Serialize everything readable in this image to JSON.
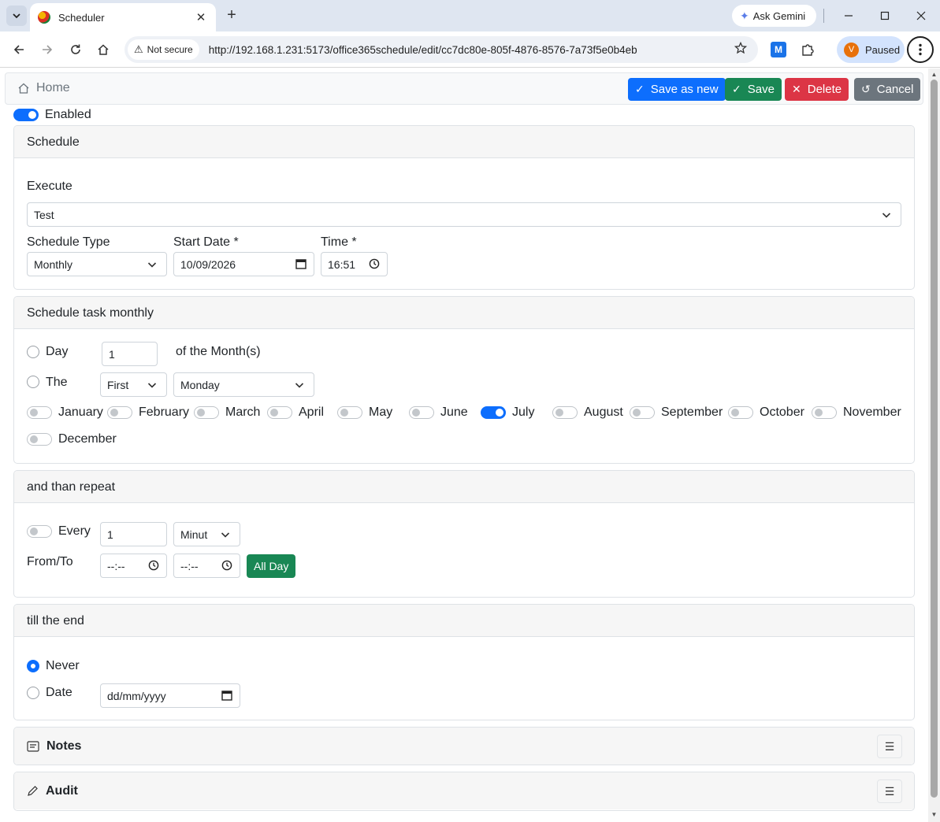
{
  "browser": {
    "tab_title": "Scheduler",
    "tab_close": "✕",
    "new_tab": "+",
    "gemini_label": "Ask Gemini",
    "security_label": "Not secure",
    "url": "http://192.168.1.231:5173/office365schedule/edit/cc7dc80e-805f-4876-8576-7a73f5e0b4eb",
    "profile_initial": "V",
    "profile_status": "Paused",
    "extension_label": "M"
  },
  "toolbar": {
    "home_label": "Home",
    "save_as_new_label": "Save as new",
    "save_label": "Save",
    "delete_label": "Delete",
    "cancel_label": "Cancel"
  },
  "enabled_label": "Enabled",
  "schedule": {
    "header": "Schedule",
    "execute_label": "Execute",
    "execute_value": "Test",
    "type_label": "Schedule Type",
    "type_value": "Monthly",
    "start_date_label": "Start Date *",
    "start_date_value": "10/09/2026",
    "time_label": "Time *",
    "time_value": "16:51"
  },
  "monthly": {
    "header": "Schedule task monthly",
    "day_label": "Day",
    "day_value": "1",
    "of_month_label": "of the Month(s)",
    "the_label": "The",
    "ordinal_value": "First",
    "weekday_value": "Monday",
    "months": [
      {
        "label": "January",
        "on": false
      },
      {
        "label": "February",
        "on": false
      },
      {
        "label": "March",
        "on": false
      },
      {
        "label": "April",
        "on": false
      },
      {
        "label": "May",
        "on": false
      },
      {
        "label": "June",
        "on": false
      },
      {
        "label": "July",
        "on": true
      },
      {
        "label": "August",
        "on": false
      },
      {
        "label": "September",
        "on": false
      },
      {
        "label": "October",
        "on": false
      },
      {
        "label": "November",
        "on": false
      },
      {
        "label": "December",
        "on": false
      }
    ]
  },
  "repeat": {
    "header": "and than repeat",
    "every_label": "Every",
    "every_value": "1",
    "unit_value": "Minut",
    "fromto_label": "From/To",
    "from_value": "--:--",
    "to_value": "--:--",
    "allday_label": "All Day"
  },
  "end": {
    "header": "till the end",
    "never_label": "Never",
    "date_label": "Date",
    "date_placeholder": "dd/mm/yyyy"
  },
  "notes": {
    "header": "Notes",
    "toggle": "☰"
  },
  "audit": {
    "header": "Audit",
    "toggle": "☰"
  }
}
